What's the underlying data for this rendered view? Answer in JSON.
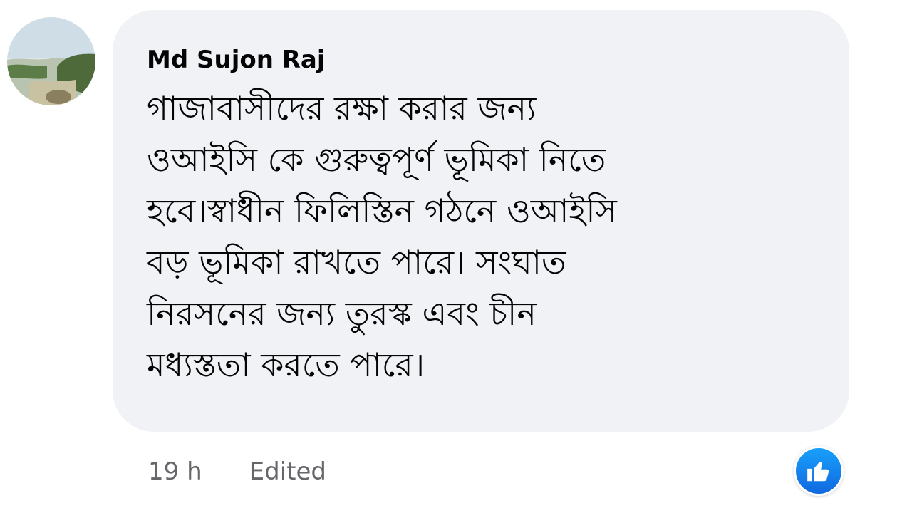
{
  "comment": {
    "author": "Md Sujon Raj",
    "avatar": {
      "icon": "landscape-avatar"
    },
    "text_lines": [
      "গাজাবাসীদের রক্ষা করার জন্য",
      "ওআইসি কে গুরুত্বপূর্ণ ভূমিকা নিতে",
      "হবে।স্বাধীন ফিলিস্তিন গঠনে ওআইসি",
      "বড় ভূমিকা রাখতে পারে। সংঘাত",
      "নিরসনের জন্য তুরস্ক এবং চীন",
      "মধ্যস্ততা করতে পারে।"
    ],
    "timestamp": "19 h",
    "edited_label": "Edited",
    "reaction": {
      "icon": "like-thumbs-up-icon",
      "color": "#1877f2"
    }
  },
  "colors": {
    "bubble": "#f0f2f5",
    "text": "#050505",
    "meta": "#65676b"
  }
}
